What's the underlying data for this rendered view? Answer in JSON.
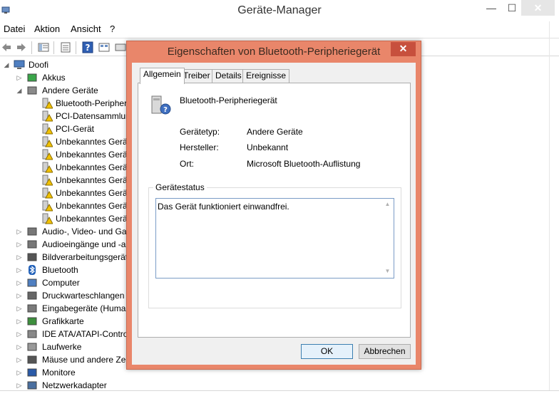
{
  "window": {
    "title": "Geräte-Manager",
    "minimize": "—",
    "maximize": "☐",
    "close": "✕"
  },
  "menu": [
    "Datei",
    "Aktion",
    "Ansicht",
    "?"
  ],
  "tree": {
    "root": "Doofi",
    "items": [
      {
        "label": "Akkus",
        "indent": 1,
        "expander": "collapsed",
        "icon": "battery-icon"
      },
      {
        "label": "Andere Geräte",
        "indent": 1,
        "expander": "expanded",
        "icon": "unknown-device-icon"
      },
      {
        "label": "Bluetooth-Peripher",
        "indent": 2,
        "expander": "none",
        "icon": "warning-device-icon"
      },
      {
        "label": "PCI-Datensammlun",
        "indent": 2,
        "expander": "none",
        "icon": "warning-device-icon"
      },
      {
        "label": "PCI-Gerät",
        "indent": 2,
        "expander": "none",
        "icon": "warning-device-icon"
      },
      {
        "label": "Unbekanntes Geräte",
        "indent": 2,
        "expander": "none",
        "icon": "warning-device-icon"
      },
      {
        "label": "Unbekanntes Gerät",
        "indent": 2,
        "expander": "none",
        "icon": "warning-device-icon"
      },
      {
        "label": "Unbekanntes Gerät",
        "indent": 2,
        "expander": "none",
        "icon": "warning-device-icon"
      },
      {
        "label": "Unbekanntes Gerät",
        "indent": 2,
        "expander": "none",
        "icon": "warning-device-icon"
      },
      {
        "label": "Unbekanntes Gerät",
        "indent": 2,
        "expander": "none",
        "icon": "warning-device-icon"
      },
      {
        "label": "Unbekanntes Gerät",
        "indent": 2,
        "expander": "none",
        "icon": "warning-device-icon"
      },
      {
        "label": "Unbekanntes Gerät",
        "indent": 2,
        "expander": "none",
        "icon": "warning-device-icon"
      },
      {
        "label": "Audio-, Video- und Ga",
        "indent": 1,
        "expander": "collapsed",
        "icon": "speaker-icon"
      },
      {
        "label": "Audioeingänge und -a",
        "indent": 1,
        "expander": "collapsed",
        "icon": "speaker-icon"
      },
      {
        "label": "Bildverarbeitungsgerät",
        "indent": 1,
        "expander": "collapsed",
        "icon": "camera-icon"
      },
      {
        "label": "Bluetooth",
        "indent": 1,
        "expander": "collapsed",
        "icon": "bluetooth-icon"
      },
      {
        "label": "Computer",
        "indent": 1,
        "expander": "collapsed",
        "icon": "computer-icon"
      },
      {
        "label": "Druckwarteschlangen",
        "indent": 1,
        "expander": "collapsed",
        "icon": "printer-icon"
      },
      {
        "label": "Eingabegeräte (Human",
        "indent": 1,
        "expander": "collapsed",
        "icon": "input-device-icon"
      },
      {
        "label": "Grafikkarte",
        "indent": 1,
        "expander": "collapsed",
        "icon": "graphics-card-icon"
      },
      {
        "label": "IDE ATA/ATAPI-Contro",
        "indent": 1,
        "expander": "collapsed",
        "icon": "ide-controller-icon"
      },
      {
        "label": "Laufwerke",
        "indent": 1,
        "expander": "collapsed",
        "icon": "drive-icon"
      },
      {
        "label": "Mäuse und andere Zei",
        "indent": 1,
        "expander": "collapsed",
        "icon": "mouse-icon"
      },
      {
        "label": "Monitore",
        "indent": 1,
        "expander": "collapsed",
        "icon": "monitor-icon"
      },
      {
        "label": "Netzwerkadapter",
        "indent": 1,
        "expander": "collapsed",
        "icon": "network-adapter-icon"
      }
    ]
  },
  "dialog": {
    "title": "Eigenschaften von Bluetooth-Peripheriegerät",
    "close": "✕",
    "tabs": [
      "Allgemein",
      "Treiber",
      "Details",
      "Ereignisse"
    ],
    "active_tab": "Allgemein",
    "device_name": "Bluetooth-Peripheriegerät",
    "properties": [
      {
        "label": "Gerätetyp:",
        "value": "Andere Geräte"
      },
      {
        "label": "Hersteller:",
        "value": "Unbekannt"
      },
      {
        "label": "Ort:",
        "value": "Microsoft Bluetooth-Auflistung"
      }
    ],
    "status_group": "Gerätestatus",
    "status_text": "Das Gerät funktioniert einwandfrei.",
    "ok": "OK",
    "cancel": "Abbrechen"
  }
}
